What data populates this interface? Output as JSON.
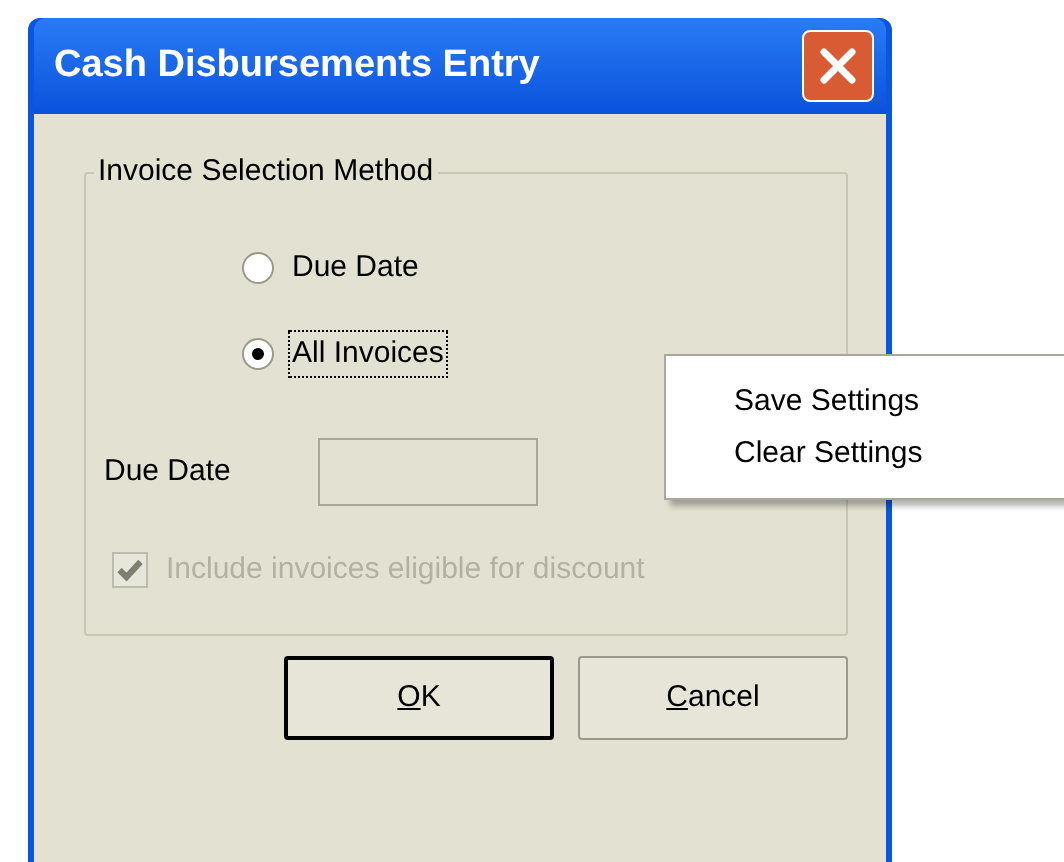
{
  "window": {
    "title": "Cash Disbursements Entry"
  },
  "group": {
    "title": "Invoice Selection Method",
    "options": [
      {
        "label": "Due Date",
        "selected": false
      },
      {
        "label": "All Invoices",
        "selected": true
      }
    ]
  },
  "due_date": {
    "label": "Due Date",
    "disabled": true
  },
  "include_discount": {
    "label": "Include invoices eligible for discount",
    "checked": true,
    "disabled": true
  },
  "buttons": [
    {
      "label": "OK",
      "default": true
    },
    {
      "label": "Cancel",
      "default": false
    }
  ],
  "context_menu": {
    "items": [
      "Save Settings",
      "Clear Settings"
    ]
  }
}
